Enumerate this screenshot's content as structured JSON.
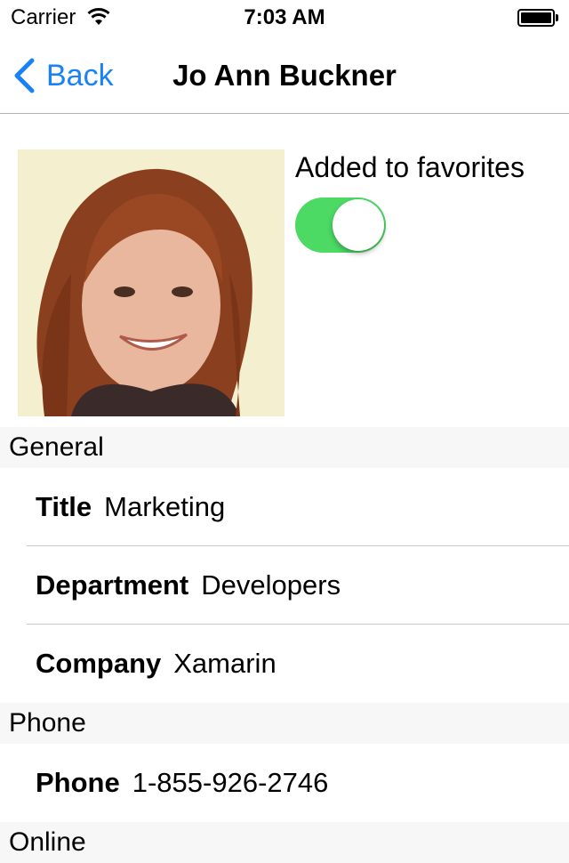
{
  "status_bar": {
    "carrier": "Carrier",
    "time": "7:03 AM"
  },
  "nav": {
    "back_label": "Back",
    "title": "Jo Ann Buckner"
  },
  "favorite": {
    "label": "Added to favorites",
    "enabled": true,
    "accent": "#4cd964"
  },
  "sections": {
    "general": {
      "header": "General",
      "rows": [
        {
          "key": "Title",
          "value": "Marketing"
        },
        {
          "key": "Department",
          "value": "Developers"
        },
        {
          "key": "Company",
          "value": "Xamarin"
        }
      ]
    },
    "phone": {
      "header": "Phone",
      "rows": [
        {
          "key": "Phone",
          "value": "1-855-926-2746"
        }
      ]
    },
    "online": {
      "header": "Online"
    }
  },
  "colors": {
    "link": "#1a82f7",
    "section_bg": "#f7f7f7",
    "separator": "#c8c7cc"
  }
}
